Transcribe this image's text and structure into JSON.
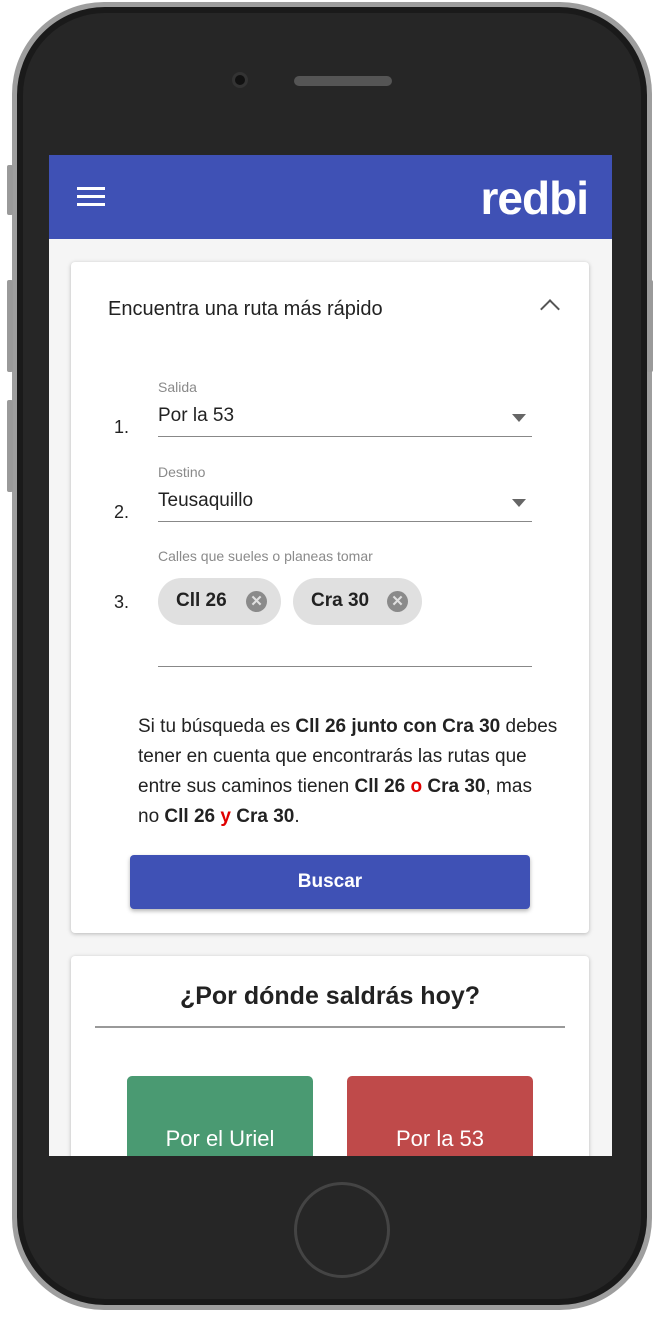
{
  "header": {
    "logo": "redbi"
  },
  "route_card": {
    "title": "Encuentra una ruta más rápido",
    "fields": [
      {
        "number": "1.",
        "label": "Salida",
        "value": "Por la 53"
      },
      {
        "number": "2.",
        "label": "Destino",
        "value": "Teusaquillo"
      }
    ],
    "streets": {
      "number": "3.",
      "label": "Calles que sueles o planeas tomar",
      "chips": [
        "Cll 26",
        "Cra 30"
      ]
    },
    "note": [
      "Si tu búsqueda es ",
      "Cll 26 junto con Cra 30",
      " debes tener en cuenta que encontrarás las rutas que entre sus caminos tienen ",
      "Cll 26",
      " o ",
      "Cra 30",
      ", mas no ",
      "Cll 26",
      " y ",
      "Cra 30",
      "."
    ],
    "button": "Buscar"
  },
  "departure_card": {
    "title": "¿Por dónde saldrás hoy?",
    "options": [
      {
        "label": "Por el Uriel",
        "color": "#4a9a72"
      },
      {
        "label": "Por la 53",
        "color": "#bf4a4a"
      }
    ]
  }
}
